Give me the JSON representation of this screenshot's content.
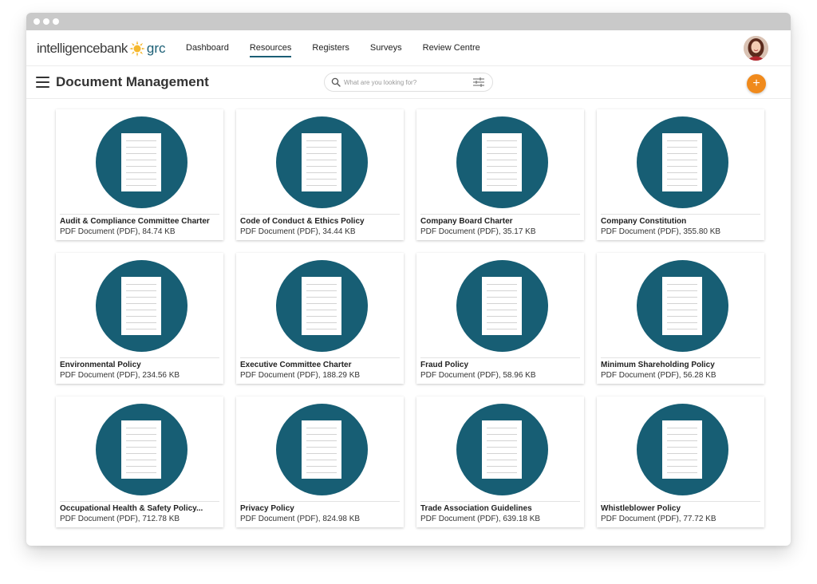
{
  "brand": {
    "name": "intelligencebank",
    "product": "grc"
  },
  "nav": {
    "items": [
      {
        "label": "Dashboard",
        "active": false
      },
      {
        "label": "Resources",
        "active": true
      },
      {
        "label": "Registers",
        "active": false
      },
      {
        "label": "Surveys",
        "active": false
      },
      {
        "label": "Review Centre",
        "active": false
      }
    ]
  },
  "header": {
    "title": "Document Management"
  },
  "search": {
    "placeholder": "What are you looking for?",
    "value": ""
  },
  "add_button": {
    "label": "+"
  },
  "documents": [
    {
      "title": "Audit & Compliance Committee Charter",
      "meta": "PDF Document (PDF), 84.74 KB"
    },
    {
      "title": "Code of Conduct & Ethics Policy",
      "meta": "PDF Document (PDF), 34.44 KB"
    },
    {
      "title": "Company Board Charter",
      "meta": "PDF Document (PDF), 35.17 KB"
    },
    {
      "title": "Company Constitution",
      "meta": "PDF Document (PDF), 355.80 KB"
    },
    {
      "title": "Environmental Policy",
      "meta": "PDF Document (PDF), 234.56 KB"
    },
    {
      "title": "Executive Committee Charter",
      "meta": "PDF Document (PDF), 188.29 KB"
    },
    {
      "title": "Fraud Policy",
      "meta": "PDF Document (PDF), 58.96 KB"
    },
    {
      "title": "Minimum Shareholding Policy",
      "meta": "PDF Document (PDF), 56.28 KB"
    },
    {
      "title": "Occupational Health & Safety Policy...",
      "meta": "PDF Document (PDF), 712.78 KB"
    },
    {
      "title": "Privacy Policy",
      "meta": "PDF Document (PDF), 824.98 KB"
    },
    {
      "title": "Trade Association Guidelines",
      "meta": "PDF Document (PDF), 639.18 KB"
    },
    {
      "title": "Whistleblower Policy",
      "meta": "PDF Document (PDF), 77.72 KB"
    }
  ],
  "colors": {
    "accent": "#1a5e75",
    "thumbnail": "#175e74",
    "add_button": "#f08a1c",
    "logo_sun": "#f5b82e"
  },
  "icons": {
    "menu": "hamburger-menu-icon",
    "search": "search-icon",
    "filter": "filter-sliders-icon",
    "add": "plus-icon",
    "document": "document-icon",
    "logo": "sun-logo-icon"
  }
}
